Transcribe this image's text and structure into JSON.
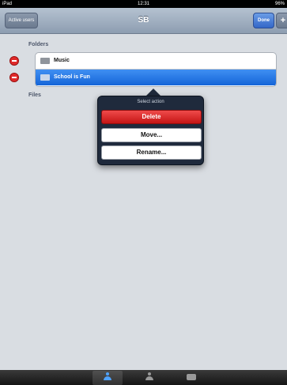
{
  "status_bar": {
    "device": "iPad",
    "time": "12:31",
    "battery": "96%"
  },
  "nav": {
    "back_label": "Active users",
    "title": "SB",
    "done_label": "Done",
    "add_label": "+"
  },
  "folders_header": "Folders",
  "folders": [
    {
      "name": "Music",
      "selected": false,
      "icon": "folder-icon"
    },
    {
      "name": "School is Fun",
      "selected": true,
      "icon": "folder-icon"
    }
  ],
  "files_header": "Files",
  "popover": {
    "title": "Select action",
    "delete_label": "Delete",
    "move_label": "Move...",
    "rename_label": "Rename..."
  },
  "tabbar": {
    "tabs": [
      {
        "icon": "person-icon",
        "active": true
      },
      {
        "icon": "person-icon",
        "active": false
      },
      {
        "icon": "tray-icon",
        "active": false
      }
    ]
  },
  "colors": {
    "selection_blue": "#1565d8",
    "delete_red": "#c51515",
    "background": "#d9dde2"
  }
}
